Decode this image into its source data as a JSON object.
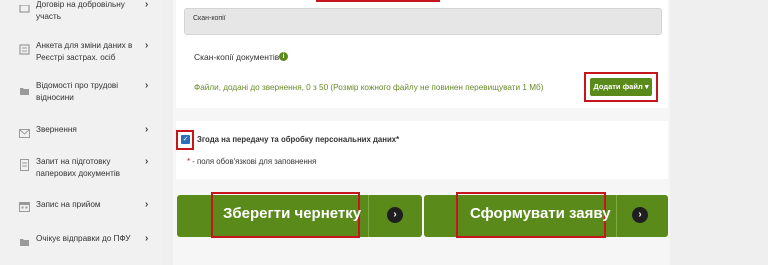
{
  "sidebar": {
    "items": [
      {
        "label": "Договір на добровільну участь",
        "icon": "document-icon"
      },
      {
        "label": "Анкета для зміни даних в Реєстрі застрах. осіб",
        "icon": "form-icon"
      },
      {
        "label": "Відомості про трудові відносини",
        "icon": "folder-icon"
      },
      {
        "label": "Звернення",
        "icon": "envelope-icon"
      },
      {
        "label": "Запит на підготовку паперових документів",
        "icon": "paper-icon"
      },
      {
        "label": "Запис на прийом",
        "icon": "calendar-icon"
      },
      {
        "label": "Очікує відправки до ПФУ",
        "icon": "folder-icon"
      }
    ],
    "chevron": "›"
  },
  "scan": {
    "header": "Скан-копії",
    "docs_label": "Скан-копії документів",
    "info_glyph": "i",
    "files_text": "Файли, додані до звернення, 0 з 50 (Розмір кожного файлу не повинен перевищувати 1 Мб)",
    "add_file": "Додати файл ▾"
  },
  "consent": {
    "check_glyph": "✓",
    "label": "Згода на передачу та обробку персональних даних*",
    "required_star": "*",
    "required_note": " - поля обов'язкові для заповнення"
  },
  "actions": {
    "save_draft": "Зберегти чернетку",
    "create_request": "Сформувати заяву",
    "arrow_glyph": "›"
  },
  "colors": {
    "accent_green": "#5a8a1a",
    "highlight_red": "#c4161c",
    "checkbox_blue": "#2a6fbf"
  }
}
